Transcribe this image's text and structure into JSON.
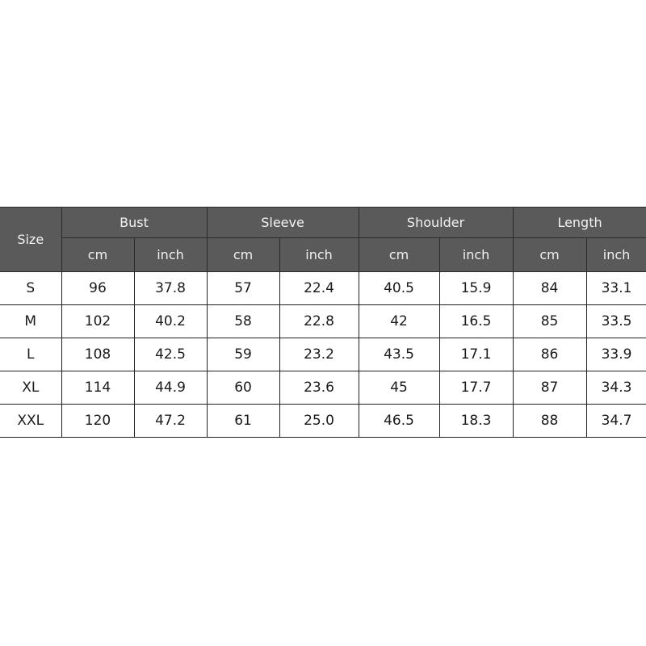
{
  "table": {
    "size_header": "Size",
    "groups": [
      "Bust",
      "Sleeve",
      "Shoulder",
      "Length"
    ],
    "units": [
      "cm",
      "inch",
      "cm",
      "inch",
      "cm",
      "inch",
      "cm",
      "inch"
    ],
    "rows": [
      [
        "S",
        "96",
        "37.8",
        "57",
        "22.4",
        "40.5",
        "15.9",
        "84",
        "33.1"
      ],
      [
        "M",
        "102",
        "40.2",
        "58",
        "22.8",
        "42",
        "16.5",
        "85",
        "33.5"
      ],
      [
        "L",
        "108",
        "42.5",
        "59",
        "23.2",
        "43.5",
        "17.1",
        "86",
        "33.9"
      ],
      [
        "XL",
        "114",
        "44.9",
        "60",
        "23.6",
        "45",
        "17.7",
        "87",
        "34.3"
      ],
      [
        "XXL",
        "120",
        "47.2",
        "61",
        "25.0",
        "46.5",
        "18.3",
        "88",
        "34.7"
      ]
    ],
    "colors": {
      "header_bg": "#5a5a5a",
      "header_text": "#f2f2f2",
      "border": "#222222"
    }
  }
}
